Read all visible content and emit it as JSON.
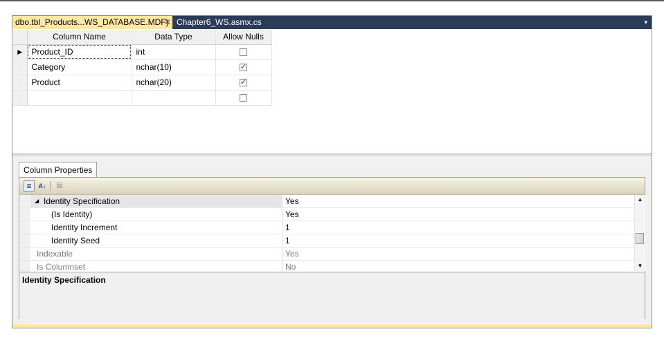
{
  "tabs": [
    {
      "label": "dbo.tbl_Products...WS_DATABASE.MDF)",
      "close": "✕"
    },
    {
      "label": "Chapter6_WS.asmx.cs"
    }
  ],
  "tab_dropdown": "▾",
  "grid": {
    "headers": [
      "Column Name",
      "Data Type",
      "Allow Nulls"
    ],
    "rows": [
      {
        "name": "Product_ID",
        "type": "int",
        "allow_nulls": false,
        "current": true
      },
      {
        "name": "Category",
        "type": "nchar(10)",
        "allow_nulls": true
      },
      {
        "name": "Product",
        "type": "nchar(20)",
        "allow_nulls": true
      },
      {
        "name": "",
        "type": "",
        "allow_nulls": false
      }
    ],
    "current_row_marker": "▶"
  },
  "properties_tab": "Column Properties",
  "toolbar": {
    "categorized_icon": "categorized-icon",
    "alphabetical_icon": "sort-az-icon",
    "alphabetical_glyph": "A↓",
    "pages_icon": "property-pages-icon",
    "pages_glyph": "▤"
  },
  "properties": [
    {
      "name": "Identity Specification",
      "value": "Yes",
      "level": 0,
      "expander": "◢",
      "highlight": true
    },
    {
      "name": "(Is Identity)",
      "value": "Yes",
      "level": 1
    },
    {
      "name": "Identity Increment",
      "value": "1",
      "level": 1
    },
    {
      "name": "Identity Seed",
      "value": "1",
      "level": 1
    },
    {
      "name": "Indexable",
      "value": "Yes",
      "level": 0,
      "dim": true
    },
    {
      "name": "Is Columnset",
      "value": "No",
      "level": 0,
      "dim": true
    }
  ],
  "scroll": {
    "up": "▲",
    "down": "▼"
  },
  "description": {
    "title": "Identity Specification"
  },
  "colors": {
    "tab_active": "#ffe8a6",
    "tabstrip": "#2b3c59",
    "check": "#1e3287"
  }
}
